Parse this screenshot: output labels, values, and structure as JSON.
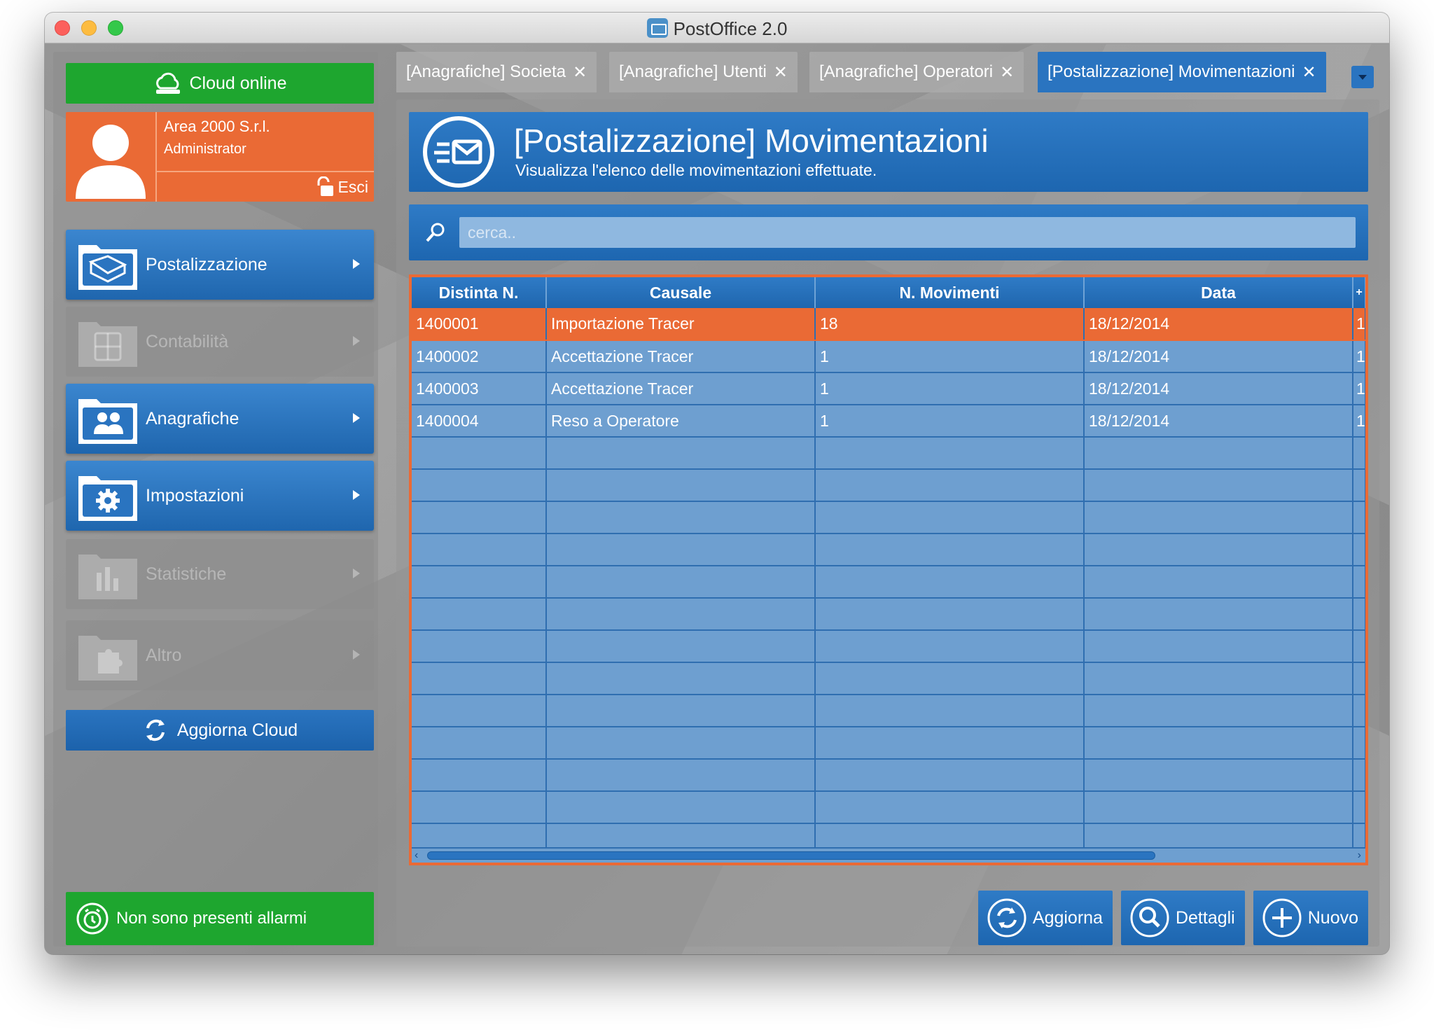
{
  "window": {
    "title": "PostOffice 2.0"
  },
  "sidebar": {
    "cloud_status": "Cloud online",
    "user": {
      "company": "Area 2000 S.r.l.",
      "role": "Administrator",
      "logout_label": "Esci"
    },
    "items": [
      {
        "label": "Postalizzazione",
        "enabled": true,
        "icon": "mail-folder-icon"
      },
      {
        "label": "Contabilità",
        "enabled": false,
        "icon": "calculator-folder-icon"
      },
      {
        "label": "Anagrafiche",
        "enabled": true,
        "icon": "users-folder-icon"
      },
      {
        "label": "Impostazioni",
        "enabled": true,
        "icon": "gear-folder-icon"
      },
      {
        "label": "Statistiche",
        "enabled": false,
        "icon": "chart-folder-icon"
      },
      {
        "label": "Altro",
        "enabled": false,
        "icon": "puzzle-folder-icon"
      }
    ],
    "refresh_cloud_label": "Aggiorna Cloud",
    "alarms_label": "Non sono presenti allarmi"
  },
  "tabs": [
    {
      "label": "[Anagrafiche] Societa",
      "active": false
    },
    {
      "label": "[Anagrafiche] Utenti",
      "active": false
    },
    {
      "label": "[Anagrafiche] Operatori",
      "active": false
    },
    {
      "label": "[Postalizzazione] Movimentazioni",
      "active": true
    }
  ],
  "tab_close_glyph": "✕",
  "header": {
    "title": "[Postalizzazione] Movimentazioni",
    "subtitle": "Visualizza l'elenco delle movimentazioni effettuate."
  },
  "search": {
    "placeholder": "cerca..",
    "value": ""
  },
  "table": {
    "columns": [
      "Distinta N.",
      "Causale",
      "N. Movimenti",
      "Data",
      "+"
    ],
    "rows": [
      [
        "1400001",
        "Importazione Tracer",
        "18",
        "18/12/2014",
        "1"
      ],
      [
        "1400002",
        "Accettazione Tracer",
        "1",
        "18/12/2014",
        "1"
      ],
      [
        "1400003",
        "Accettazione Tracer",
        "1",
        "18/12/2014",
        "1"
      ],
      [
        "1400004",
        "Reso a Operatore",
        "1",
        "18/12/2014",
        "1"
      ]
    ],
    "selected_row": 0,
    "scroll_left": "‹",
    "scroll_right": "›"
  },
  "actions": {
    "refresh_label": "Aggiorna",
    "details_label": "Dettagli",
    "new_label": "Nuovo"
  },
  "colors": {
    "accent_blue": "#2a74c0",
    "accent_orange": "#ea6a35",
    "accent_green": "#1ea62f"
  }
}
